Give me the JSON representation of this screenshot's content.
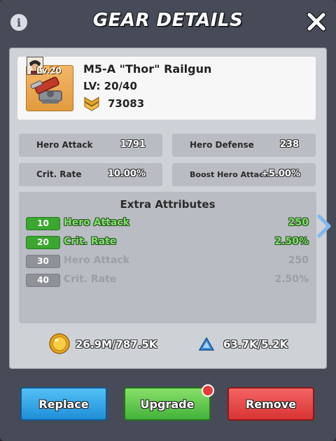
{
  "header": {
    "title": "GEAR DETAILS",
    "info_icon": "info-icon",
    "close_icon": "close-icon"
  },
  "gear": {
    "level_badge": "Lv.20",
    "name": "M5-A \"Thor\" Railgun",
    "level": "LV: 20/40",
    "power": "73083"
  },
  "stats": [
    {
      "label": "Hero Attack",
      "value": "1791"
    },
    {
      "label": "Hero Defense",
      "value": "238"
    },
    {
      "label": "Crit. Rate",
      "value": "10.00%"
    },
    {
      "label": "Boost Hero Attack",
      "value": "+5.00%"
    }
  ],
  "extra": {
    "title": "Extra Attributes",
    "rows": [
      {
        "tag": "10",
        "name": "Hero Attack",
        "value": "250",
        "unlocked": true
      },
      {
        "tag": "20",
        "name": "Crit. Rate",
        "value": "2.50%",
        "unlocked": true
      },
      {
        "tag": "30",
        "name": "Hero Attack",
        "value": "250",
        "unlocked": false
      },
      {
        "tag": "40",
        "name": "Crit. Rate",
        "value": "2.50%",
        "unlocked": false
      }
    ]
  },
  "costs": {
    "coins": "26.9M/787.5K",
    "crystals": "63.7K/5.2K"
  },
  "buttons": {
    "replace": "Replace",
    "upgrade": "Upgrade",
    "remove": "Remove"
  },
  "colors": {
    "frame": "#474b57",
    "panel": "#ced1d6",
    "active_green": "#7fe26a",
    "replace_blue": "#1f8ed8",
    "upgrade_green": "#43b23a",
    "remove_red": "#d83434"
  }
}
